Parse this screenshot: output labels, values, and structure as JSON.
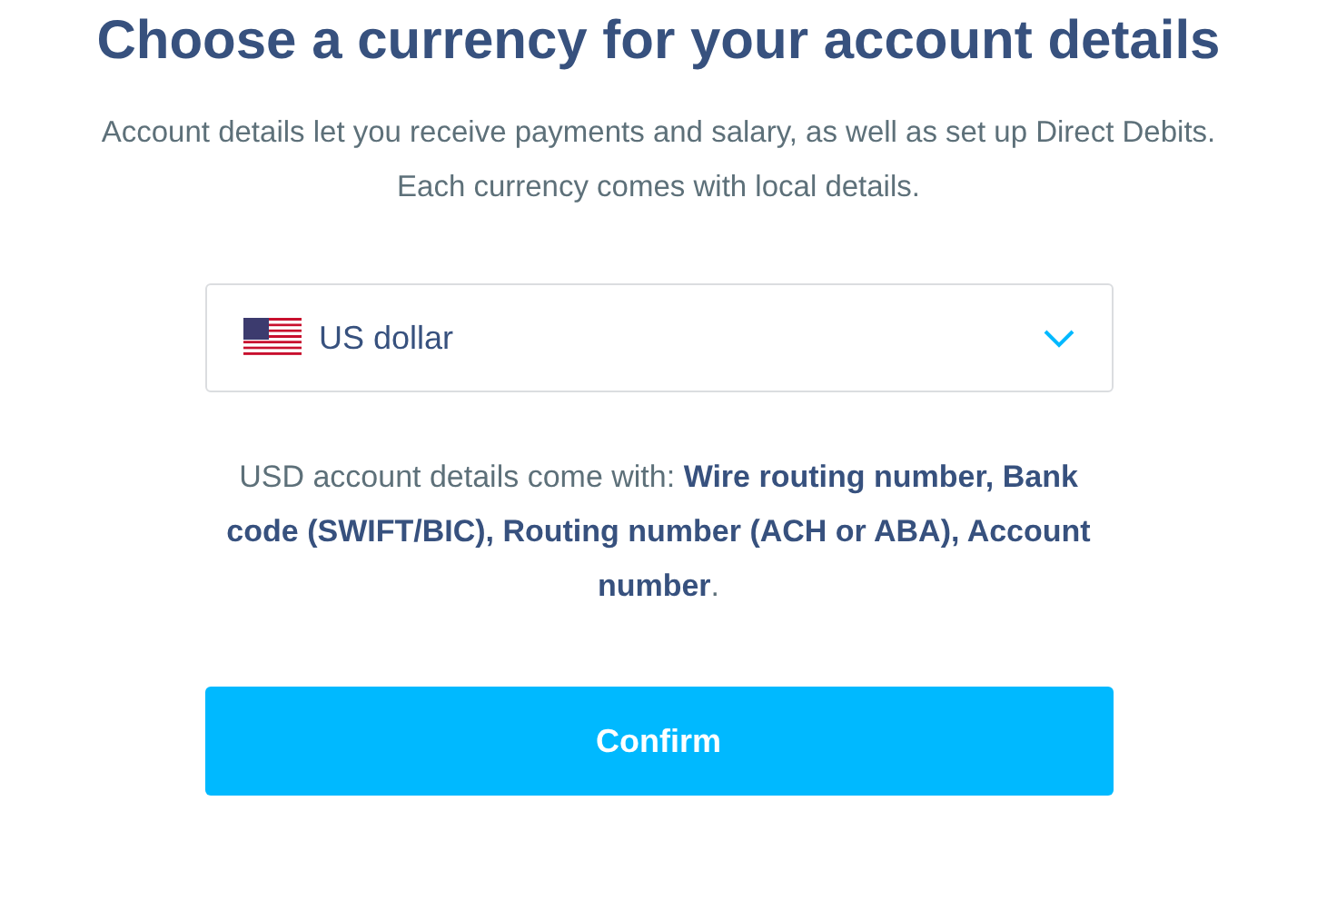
{
  "title": "Choose a currency for your account details",
  "subtitle": "Account details let you receive payments and salary, as well as set up Direct Debits. Each currency comes with local details.",
  "currency_select": {
    "value": "US dollar"
  },
  "details_note": "USD account details come with: **Wire routing number, Bank code (SWIFT/BIC), Routing number (ACH or ABA), Account number**.",
  "confirm_button": "Confirm"
}
